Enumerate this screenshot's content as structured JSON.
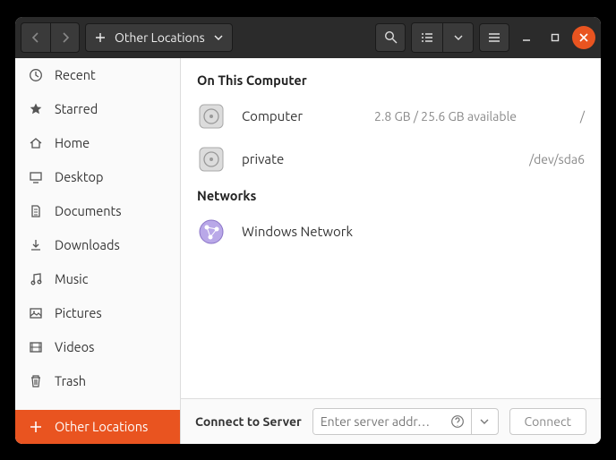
{
  "header": {
    "location_label": "Other Locations"
  },
  "sidebar": {
    "items": [
      {
        "label": "Recent"
      },
      {
        "label": "Starred"
      },
      {
        "label": "Home"
      },
      {
        "label": "Desktop"
      },
      {
        "label": "Documents"
      },
      {
        "label": "Downloads"
      },
      {
        "label": "Music"
      },
      {
        "label": "Pictures"
      },
      {
        "label": "Videos"
      },
      {
        "label": "Trash"
      }
    ],
    "other_locations_label": "Other Locations"
  },
  "main": {
    "section_computer": "On This Computer",
    "section_networks": "Networks",
    "computer": {
      "name": "Computer",
      "info": "2.8 GB / 25.6 GB available",
      "path": "/"
    },
    "private": {
      "name": "private",
      "info": "",
      "path": "/dev/sda6"
    },
    "winnet": {
      "name": "Windows Network"
    }
  },
  "footer": {
    "label": "Connect to Server",
    "placeholder": "Enter server addr…",
    "connect": "Connect"
  }
}
